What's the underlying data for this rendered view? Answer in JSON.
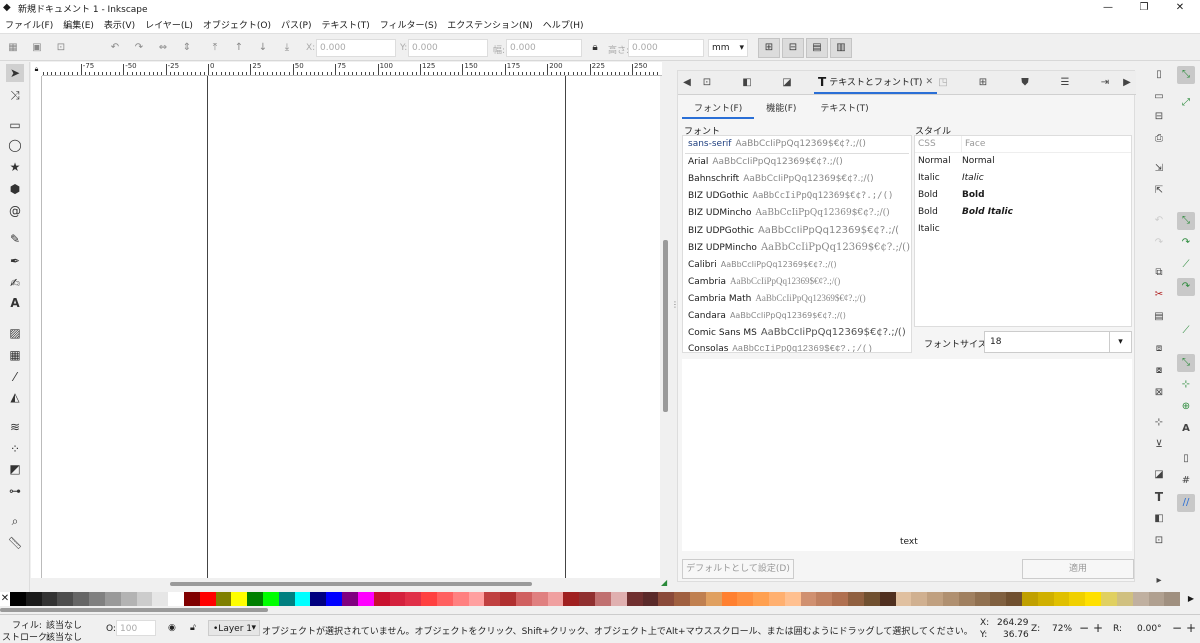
{
  "window": {
    "title": "新規ドキュメント 1 - Inkscape",
    "minimize": "—",
    "maximize": "❐",
    "close": "✕"
  },
  "menu": [
    "ファイル(F)",
    "編集(E)",
    "表示(V)",
    "レイヤー(L)",
    "オブジェクト(O)",
    "パス(P)",
    "テキスト(T)",
    "フィルター(S)",
    "エクステンション(N)",
    "ヘルプ(H)"
  ],
  "toolbar": {
    "x_label": "X:",
    "x_value": "0.000",
    "y_label": "Y:",
    "y_value": "0.000",
    "w_label": "幅:",
    "w_value": "0.000",
    "h_label": "高さ:",
    "h_value": "0.000",
    "unit": "mm"
  },
  "ruler": {
    "labels": [
      "-75",
      "-50",
      "-25",
      "0",
      "25",
      "50",
      "75",
      "100",
      "125",
      "150",
      "175",
      "200",
      "225",
      "250"
    ]
  },
  "panel": {
    "tab_title": "テキストとフォント(T)",
    "subtabs": [
      "フォント(F)",
      "機能(F)",
      "テキスト(T)"
    ],
    "font_section_label": "フォント",
    "style_section_label": "スタイル",
    "fonts": [
      {
        "name": "sans-serif",
        "sample": "AaBbCcIiPpQq12369$€¢?.;/()"
      },
      {
        "name": "Arial",
        "sample": "AaBbCcIiPpQq12369$€¢?.;/()"
      },
      {
        "name": "Bahnschrift",
        "sample": "AaBbCcIiPpQq12369$€¢?.;/()"
      },
      {
        "name": "BIZ UDGothic",
        "sample": "AaBbCcIiPpQq12369$€¢?.;/()"
      },
      {
        "name": "BIZ UDMincho",
        "sample": "AaBbCcIiPpQq12369$€¢?.;/()"
      },
      {
        "name": "BIZ UDPGothic",
        "sample": "AaBbCcIiPpQq12369$€¢?.;/("
      },
      {
        "name": "BIZ UDPMincho",
        "sample": "AaBbCcIiPpQq12369$€¢?.;/()"
      },
      {
        "name": "Calibri",
        "sample": "AaBbCcIiPpQq12369$€¢?.;/()"
      },
      {
        "name": "Cambria",
        "sample": "AaBbCcIiPpQq12369$€¢?.;/()"
      },
      {
        "name": "Cambria Math",
        "sample": "AaBbCcIiPpQq12369$€¢?.;/()"
      },
      {
        "name": "Candara",
        "sample": "AaBbCcIiPpQq12369$€¢?.;/()"
      },
      {
        "name": "Comic Sans MS",
        "sample": "AaBbCcIiPpQq12369$€¢?.;/()"
      },
      {
        "name": "Consolas",
        "sample": "AaBbCcIiPpQq12369$€¢?.;/()"
      }
    ],
    "style_headers": {
      "css": "CSS",
      "face": "Face"
    },
    "styles": [
      {
        "css": "Normal",
        "face": "Normal"
      },
      {
        "css": "Italic",
        "face": "Italic"
      },
      {
        "css": "Bold",
        "face": "Bold"
      },
      {
        "css": "Bold Italic",
        "face": "Bold Italic"
      }
    ],
    "font_size_label": "フォントサイズ",
    "font_size_value": "18",
    "preview_text": "text",
    "set_default_button": "デフォルトとして設定(D)",
    "apply_button": "適用"
  },
  "status": {
    "fill_label": "フィル:",
    "fill_value": "該当なし",
    "stroke_label": "ストローク:",
    "stroke_value": "該当なし",
    "opacity_label": "O:",
    "opacity_value": "100",
    "layer": "•Layer 1",
    "message": "オブジェクトが選択されていません。オブジェクトをクリック、Shift+クリック、オブジェクト上でAlt+マウススクロール、または囲むようにドラッグして選択してください。",
    "x_label": "X:",
    "x_value": "264.29",
    "y_label": "Y:",
    "y_value": "36.76",
    "zoom_label": "Z:",
    "zoom_value": "72%",
    "rotation_label": "R:",
    "rotation_value": "0.00°"
  },
  "palette_colors": [
    "#000000",
    "#1a1a1a",
    "#333333",
    "#4d4d4d",
    "#666666",
    "#808080",
    "#999999",
    "#b3b3b3",
    "#cccccc",
    "#e6e6e6",
    "#ffffff",
    "#800000",
    "#ff0000",
    "#808000",
    "#ffff00",
    "#008000",
    "#00ff00",
    "#008080",
    "#00ffff",
    "#000080",
    "#0000ff",
    "#800080",
    "#ff00ff",
    "#c8102e",
    "#d4213d",
    "#e03048",
    "#ff4040",
    "#ff6060",
    "#ff8080",
    "#ffa0a0",
    "#c04040",
    "#b03030",
    "#d06060",
    "#e08080",
    "#f0a0a0",
    "#a02020",
    "#903030",
    "#c07070",
    "#e0b0b0",
    "#703030",
    "#5a2a2a",
    "#8a4a3a",
    "#a06040",
    "#c08050",
    "#e0a060",
    "#ff8030",
    "#ff9040",
    "#ffa050",
    "#ffb070",
    "#ffc090",
    "#d09070",
    "#c08060",
    "#b07050",
    "#906040",
    "#705030",
    "#503020",
    "#e0c0a0",
    "#d0b090",
    "#c0a080",
    "#b09070",
    "#a08060",
    "#907050",
    "#806040",
    "#705030",
    "#c0a000",
    "#d0b000",
    "#e0c000",
    "#f0d000",
    "#ffe000",
    "#e0d060",
    "#d0c080",
    "#c0b0a0",
    "#b0a090",
    "#a09080"
  ]
}
